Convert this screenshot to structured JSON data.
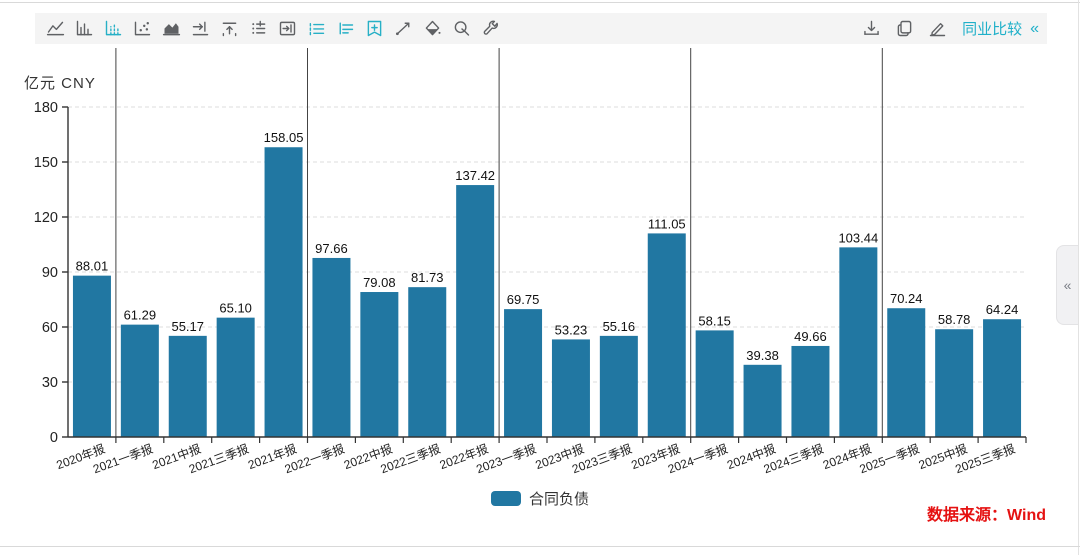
{
  "toolbar": {
    "left_icons": [
      "line-chart-icon",
      "bar-chart-icon",
      "dashed-bar-chart-icon",
      "scatter-chart-icon",
      "area-chart-icon",
      "shift-right-icon",
      "to-top-icon",
      "list-adjust-icon",
      "box-arrow-right-icon",
      "list-icon",
      "indent-list-icon",
      "bookmark-plus-icon",
      "trend-line-icon",
      "fill-color-icon",
      "zoom-search-icon",
      "wrench-icon"
    ],
    "right_icons": [
      "download-icon",
      "copy-icon",
      "edit-icon"
    ],
    "peer_comparison_label": "同业比较",
    "collapse_glyph": "«"
  },
  "chart_data": {
    "type": "bar",
    "title": "",
    "axis_title": "亿元  CNY",
    "categories": [
      "2020年报",
      "2021一季报",
      "2021中报",
      "2021三季报",
      "2021年报",
      "2022一季报",
      "2022中报",
      "2022三季报",
      "2022年报",
      "2023一季报",
      "2023中报",
      "2023三季报",
      "2023年报",
      "2024一季报",
      "2024中报",
      "2024三季报",
      "2024年报",
      "2025一季报",
      "2025中报",
      "2025三季报"
    ],
    "values": [
      88.01,
      61.29,
      55.17,
      65.1,
      158.05,
      97.66,
      79.08,
      81.73,
      137.42,
      69.75,
      53.23,
      55.16,
      111.05,
      58.15,
      39.38,
      49.66,
      103.44,
      70.24,
      58.78,
      64.24
    ],
    "ylim": [
      0,
      180
    ],
    "ytick_step": 30,
    "grid": "dashed-horizontal",
    "legend_position": "bottom-center",
    "separators_after_indices": [
      0,
      4,
      8,
      12,
      16
    ],
    "bar_color": "#2177a2",
    "legend": [
      {
        "name": "合同负债",
        "color": "#2177a2"
      }
    ]
  },
  "footer": {
    "source_label": "数据来源：Wind"
  },
  "side_panel": {
    "collapse_glyph": "«"
  },
  "colors": {
    "accent_cyan": "#1fb0c9",
    "bar": "#2177a2",
    "source_red": "#e51212",
    "axis": "#333333",
    "gridline": "#dddddd",
    "separator": "#444444",
    "toolbar_bg": "#f4f4f4"
  }
}
